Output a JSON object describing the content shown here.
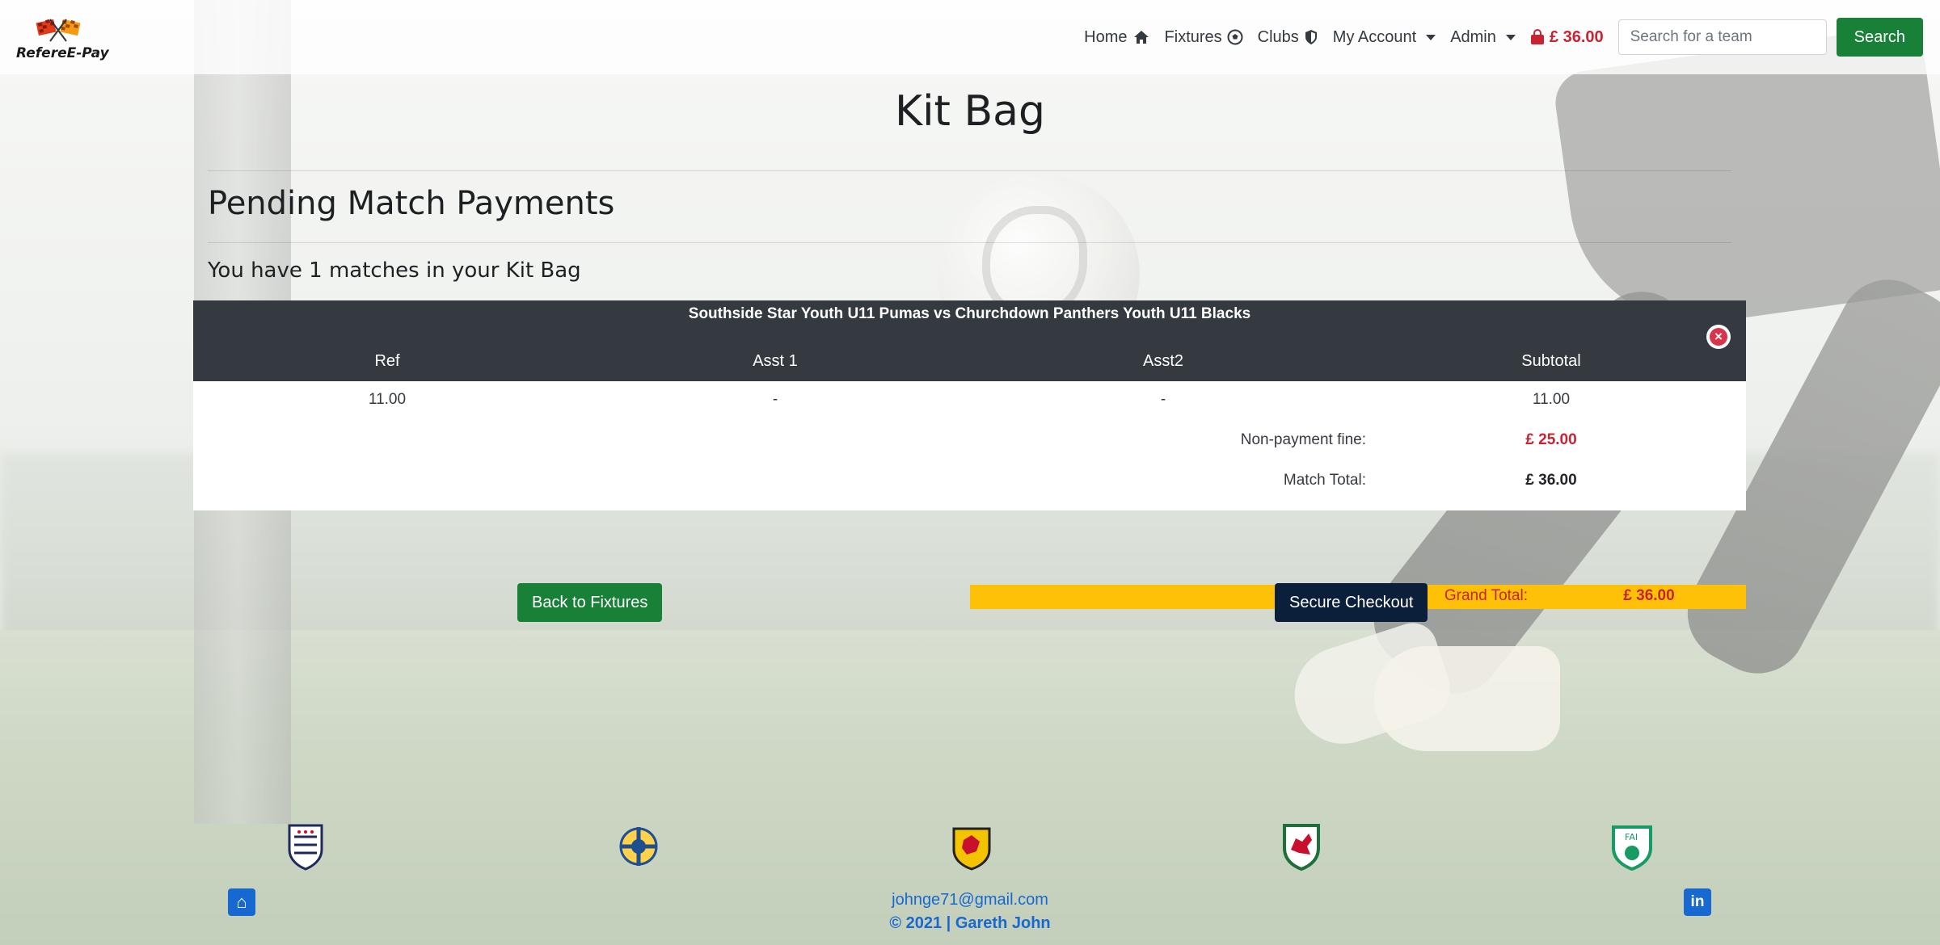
{
  "brand": {
    "name": "RefereE-Pay"
  },
  "nav": {
    "home": "Home",
    "fixtures": "Fixtures",
    "clubs": "Clubs",
    "account": "My Account",
    "admin": "Admin",
    "cart_total": "£ 36.00",
    "search_placeholder": "Search for a team",
    "search_button": "Search"
  },
  "page": {
    "title": "Kit Bag",
    "section_title": "Pending Match Payments",
    "count_text": "You have 1 matches in your Kit Bag"
  },
  "bag": {
    "match_title": "Southside Star Youth U11 Pumas vs Churchdown Panthers Youth U11 Blacks",
    "columns": [
      "Ref",
      "Asst 1",
      "Asst2",
      "Subtotal"
    ],
    "row": [
      "11.00",
      "-",
      "-",
      "11.00"
    ],
    "fine_label": "Non-payment fine:",
    "fine_value": "£ 25.00",
    "match_total_label": "Match Total:",
    "match_total_value": "£ 36.00",
    "grand_total_label": "Grand Total:",
    "grand_total_value": "£ 36.00"
  },
  "actions": {
    "back": "Back to Fixtures",
    "checkout": "Secure Checkout"
  },
  "footer": {
    "email": "johnge71@gmail.com",
    "copyright": "© 2021 | Gareth John",
    "crests": [
      "england-fa-crest",
      "northern-ireland-fa-crest",
      "scotland-fa-crest",
      "wales-fa-crest",
      "ireland-fai-crest"
    ],
    "social": [
      "github-icon",
      "linkedin-icon"
    ]
  },
  "colors": {
    "navbar_dark": "#343a40",
    "green": "#198038",
    "navy": "#0b1f3a",
    "red": "#c82333",
    "warning": "#ffc107",
    "link": "#1769d1"
  }
}
